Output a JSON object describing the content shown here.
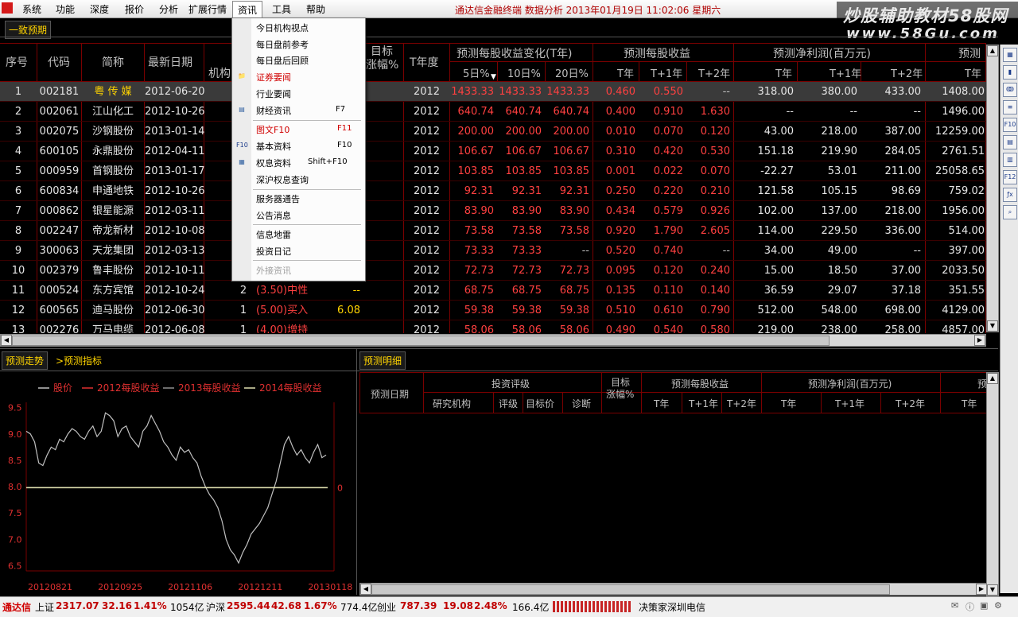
{
  "menubar": {
    "items": [
      "系统",
      "功能",
      "深度",
      "报价",
      "分析",
      "扩展行情",
      "资讯",
      "工具",
      "帮助"
    ],
    "active": "资讯",
    "title": "通达信金融终端   数据分析  2013年01月19日  11:02:06  星期六"
  },
  "watermark": {
    "line1": "炒股辅助教材58股网",
    "line2": "www.58Gu.com"
  },
  "main_tab": "一致预期",
  "table": {
    "headers": {
      "seq": "序号",
      "code": "代码",
      "name": "简称",
      "latest_date": "最新日期",
      "institution": "机构",
      "target": "目标",
      "target2": "涨幅%",
      "t_year": "T年度",
      "eps_change": "预测每股收益变化(T年)",
      "eps": "预测每股收益",
      "net_profit": "预测净利润(百万元)",
      "revenue": "预测",
      "d5": "5日%",
      "d10": "10日%",
      "d20": "20日%",
      "eps_t": "T年",
      "eps_t1": "T+1年",
      "eps_t2": "T+2年",
      "np_t": "T年",
      "np_t1": "T+1年",
      "np_t2": "T+2年",
      "rev_t": "T年"
    },
    "rows": [
      {
        "seq": "1",
        "code": "002181",
        "name": "粤 传 媒",
        "date": "2012-06-20",
        "inst": "",
        "rating": "",
        "tgt": "",
        "year": "2012",
        "d5": "1433.33",
        "d10": "1433.33",
        "d20": "1433.33",
        "e0": "0.460",
        "e1": "0.550",
        "e2": "--",
        "n0": "318.00",
        "n1": "380.00",
        "n2": "433.00",
        "rv": "1408.00"
      },
      {
        "seq": "2",
        "code": "002061",
        "name": "江山化工",
        "date": "2012-10-26",
        "inst": "",
        "rating": "",
        "tgt": "",
        "year": "2012",
        "d5": "640.74",
        "d10": "640.74",
        "d20": "640.74",
        "e0": "0.400",
        "e1": "0.910",
        "e2": "1.630",
        "n0": "--",
        "n1": "--",
        "n2": "--",
        "rv": "1496.00"
      },
      {
        "seq": "3",
        "code": "002075",
        "name": "沙钢股份",
        "date": "2013-01-14",
        "inst": "",
        "rating": "",
        "tgt": "",
        "year": "2012",
        "d5": "200.00",
        "d10": "200.00",
        "d20": "200.00",
        "e0": "0.010",
        "e1": "0.070",
        "e2": "0.120",
        "n0": "43.00",
        "n1": "218.00",
        "n2": "387.00",
        "rv": "12259.00"
      },
      {
        "seq": "4",
        "code": "600105",
        "name": "永鼎股份",
        "date": "2012-04-11",
        "inst": "",
        "rating": "",
        "tgt": "",
        "year": "2012",
        "d5": "106.67",
        "d10": "106.67",
        "d20": "106.67",
        "e0": "0.310",
        "e1": "0.420",
        "e2": "0.530",
        "n0": "151.18",
        "n1": "219.90",
        "n2": "284.05",
        "rv": "2761.51"
      },
      {
        "seq": "5",
        "code": "000959",
        "name": "首钢股份",
        "date": "2013-01-17",
        "inst": "",
        "rating": "",
        "tgt": "",
        "year": "2012",
        "d5": "103.85",
        "d10": "103.85",
        "d20": "103.85",
        "e0": "0.001",
        "e1": "0.022",
        "e2": "0.070",
        "n0": "-22.27",
        "n1": "53.01",
        "n2": "211.00",
        "rv": "25058.65"
      },
      {
        "seq": "6",
        "code": "600834",
        "name": "申通地铁",
        "date": "2012-10-26",
        "inst": "",
        "rating": "",
        "tgt": "",
        "year": "2012",
        "d5": "92.31",
        "d10": "92.31",
        "d20": "92.31",
        "e0": "0.250",
        "e1": "0.220",
        "e2": "0.210",
        "n0": "121.58",
        "n1": "105.15",
        "n2": "98.69",
        "rv": "759.02"
      },
      {
        "seq": "7",
        "code": "000862",
        "name": "银星能源",
        "date": "2012-03-11",
        "inst": "",
        "rating": "",
        "tgt": "",
        "year": "2012",
        "d5": "83.90",
        "d10": "83.90",
        "d20": "83.90",
        "e0": "0.434",
        "e1": "0.579",
        "e2": "0.926",
        "n0": "102.00",
        "n1": "137.00",
        "n2": "218.00",
        "rv": "1956.00"
      },
      {
        "seq": "8",
        "code": "002247",
        "name": "帝龙新材",
        "date": "2012-10-08",
        "inst": "",
        "rating": "",
        "tgt": "",
        "year": "2012",
        "d5": "73.58",
        "d10": "73.58",
        "d20": "73.58",
        "e0": "0.920",
        "e1": "1.790",
        "e2": "2.605",
        "n0": "114.00",
        "n1": "229.50",
        "n2": "336.00",
        "rv": "514.00"
      },
      {
        "seq": "9",
        "code": "300063",
        "name": "天龙集团",
        "date": "2012-03-13",
        "inst": "",
        "rating": "",
        "tgt": "",
        "year": "2012",
        "d5": "73.33",
        "d10": "73.33",
        "d20": "--",
        "e0": "0.520",
        "e1": "0.740",
        "e2": "--",
        "n0": "34.00",
        "n1": "49.00",
        "n2": "--",
        "rv": "397.00"
      },
      {
        "seq": "10",
        "code": "002379",
        "name": "鲁丰股份",
        "date": "2012-10-11",
        "inst": "",
        "rating": "",
        "tgt": "",
        "year": "2012",
        "d5": "72.73",
        "d10": "72.73",
        "d20": "72.73",
        "e0": "0.095",
        "e1": "0.120",
        "e2": "0.240",
        "n0": "15.00",
        "n1": "18.50",
        "n2": "37.00",
        "rv": "2033.50"
      },
      {
        "seq": "11",
        "code": "000524",
        "name": "东方宾馆",
        "date": "2012-10-24",
        "inst": "2",
        "rating": "(3.50)中性",
        "tgt": "--",
        "year": "2012",
        "d5": "68.75",
        "d10": "68.75",
        "d20": "68.75",
        "e0": "0.135",
        "e1": "0.110",
        "e2": "0.140",
        "n0": "36.59",
        "n1": "29.07",
        "n2": "37.18",
        "rv": "351.55"
      },
      {
        "seq": "12",
        "code": "600565",
        "name": "迪马股份",
        "date": "2012-06-30",
        "inst": "1",
        "rating": "(5.00)买入",
        "tgt": "6.08",
        "year": "2012",
        "d5": "59.38",
        "d10": "59.38",
        "d20": "59.38",
        "e0": "0.510",
        "e1": "0.610",
        "e2": "0.790",
        "n0": "512.00",
        "n1": "548.00",
        "n2": "698.00",
        "rv": "4129.00"
      },
      {
        "seq": "13",
        "code": "002276",
        "name": "万马电缆",
        "date": "2012-06-08",
        "inst": "1",
        "rating": "(4.00)增持",
        "tgt": "",
        "year": "2012",
        "d5": "58.06",
        "d10": "58.06",
        "d20": "58.06",
        "e0": "0.490",
        "e1": "0.540",
        "e2": "0.580",
        "n0": "219.00",
        "n1": "238.00",
        "n2": "258.00",
        "rv": "4857.00"
      }
    ]
  },
  "dropdown": {
    "items": [
      {
        "label": "今日机构视点",
        "key": "",
        "red": false
      },
      {
        "label": "每日盘前参考",
        "key": "",
        "red": false
      },
      {
        "label": "每日盘后回顾",
        "key": "",
        "red": false
      },
      {
        "label": "证券要闻",
        "key": "",
        "red": true
      },
      {
        "label": "行业要闻",
        "key": "",
        "red": false
      },
      {
        "label": "财经资讯",
        "key": "F7",
        "red": false
      },
      {
        "label": "图文F10",
        "key": "F11",
        "red": true
      },
      {
        "label": "基本资料",
        "key": "F10",
        "red": false
      },
      {
        "label": "权息资料",
        "key": "Shift+F10",
        "red": false
      },
      {
        "label": "深沪权息查询",
        "key": "",
        "red": false
      },
      {
        "label": "服务器通告",
        "key": "",
        "red": false
      },
      {
        "label": "公告消息",
        "key": "",
        "red": false
      },
      {
        "label": "信息地雷",
        "key": "",
        "red": false
      },
      {
        "label": "投资日记",
        "key": "",
        "red": false
      },
      {
        "label": "外接资讯",
        "key": "",
        "red": false
      }
    ]
  },
  "bottom_left": {
    "tab1": "预测走势",
    "tab2": ">预测指标",
    "legend": [
      "股价",
      "2012每股收益",
      "2013每股收益",
      "2014每股收益"
    ]
  },
  "bottom_right": {
    "tab": "预测明细",
    "headers": {
      "date": "预测日期",
      "rating_group": "投资评级",
      "inst": "研究机构",
      "rating": "评级",
      "target_price": "目标价",
      "diag": "诊断",
      "target_pct_1": "目标",
      "target_pct_2": "涨幅%",
      "eps": "预测每股收益",
      "net_profit": "预测净利润(百万元)",
      "rev": "预测",
      "t": "T年",
      "t1": "T+1年",
      "t2": "T+2年"
    }
  },
  "chart_data": {
    "type": "line",
    "x_ticks": [
      "20120821",
      "20120925",
      "20121106",
      "20121211",
      "20130118"
    ],
    "y_ticks": [
      "9.5",
      "9.0",
      "8.5",
      "8.0",
      "7.5",
      "7.0",
      "6.5"
    ],
    "y_right_ticks": [
      "0"
    ],
    "ylim": [
      6.4,
      9.6
    ],
    "series": [
      {
        "name": "股价",
        "color": "#c0c0c0",
        "values": [
          9.05,
          9.0,
          8.85,
          8.45,
          8.4,
          8.6,
          8.75,
          8.7,
          8.9,
          8.85,
          9.0,
          9.1,
          9.05,
          8.95,
          8.9,
          9.05,
          9.15,
          8.95,
          9.05,
          9.4,
          9.35,
          9.25,
          8.95,
          9.1,
          9.15,
          8.95,
          8.85,
          8.75,
          9.05,
          9.15,
          9.35,
          9.2,
          9.05,
          8.85,
          8.75,
          8.6,
          8.5,
          8.75,
          8.65,
          8.7,
          8.55,
          8.45,
          8.2,
          8.0,
          7.85,
          7.75,
          7.6,
          7.35,
          7.0,
          6.8,
          6.7,
          6.55,
          6.75,
          6.9,
          7.1,
          7.2,
          7.3,
          7.45,
          7.6,
          7.85,
          8.1,
          8.45,
          8.8,
          8.95,
          8.75,
          8.6,
          8.7,
          8.55,
          8.45,
          8.65,
          8.8,
          8.55,
          8.6
        ]
      },
      {
        "name": "2012每股收益",
        "color": "#e0e0b0",
        "values": [
          7.98,
          7.98
        ]
      }
    ]
  },
  "statusbar": {
    "brand": "通达信",
    "sh_label": "上证",
    "sh_val": "2317.07",
    "sh_chg": "32.16",
    "sh_pct": "1.41%",
    "sh_amt": "1054亿",
    "hs_label": "沪深",
    "hs_val": "2595.44",
    "hs_chg": "42.68",
    "hs_pct": "1.67%",
    "hs_amt": "774.4亿",
    "cy_label": "创业",
    "cy_val": "787.39",
    "cy_chg": "19.08",
    "cy_pct": "2.48%",
    "cy_amt": "166.4亿",
    "broker": "决策家深圳电信"
  }
}
